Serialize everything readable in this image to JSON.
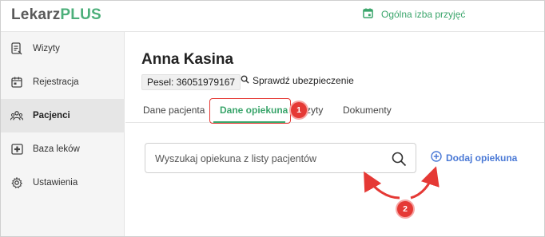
{
  "app": {
    "logo_part1": "Lekarz",
    "logo_part2": "PLUS",
    "ward_label": "Ogólna izba przyjęć"
  },
  "sidebar": {
    "items": [
      {
        "label": "Wizyty",
        "icon": "clipboard-icon",
        "active": false
      },
      {
        "label": "Rejestracja",
        "icon": "calendar-icon",
        "active": false
      },
      {
        "label": "Pacjenci",
        "icon": "people-icon",
        "active": true
      },
      {
        "label": "Baza leków",
        "icon": "medical-cross-icon",
        "active": false
      },
      {
        "label": "Ustawienia",
        "icon": "gear-icon",
        "active": false
      }
    ]
  },
  "patient": {
    "name": "Anna Kasina",
    "pesel": "Pesel: 36051979167",
    "insurance_link": "Sprawdź ubezpieczenie"
  },
  "tabs": [
    {
      "label": "Dane pacjenta",
      "active": false
    },
    {
      "label": "Dane opiekuna",
      "active": true
    },
    {
      "label": "Wizyty",
      "active": false
    },
    {
      "label": "Dokumenty",
      "active": false
    }
  ],
  "guardian": {
    "search_placeholder": "Wyszukaj opiekuna z listy pacjentów",
    "add_label": "Dodaj opiekuna"
  },
  "annotations": {
    "badge1": "1",
    "badge2": "2"
  },
  "colors": {
    "brand_green": "#3aa56b",
    "link_blue": "#4a79d6",
    "annotation_red": "#e53935"
  }
}
